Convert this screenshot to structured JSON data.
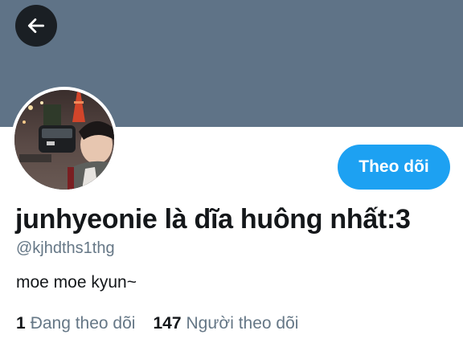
{
  "header": {
    "back_icon": "arrow-left-icon",
    "banner_color": "#5f7387"
  },
  "profile": {
    "display_name": "junhyeonie là dĩa huông nhất:3",
    "handle": "@kjhdths1thg",
    "bio": "moe moe kyun~",
    "follow_label": "Theo dõi",
    "accent_color": "#1da1f2"
  },
  "stats": {
    "following_count": "1",
    "following_label": "Đang theo dõi",
    "followers_count": "147",
    "followers_label": "Người theo dõi"
  }
}
